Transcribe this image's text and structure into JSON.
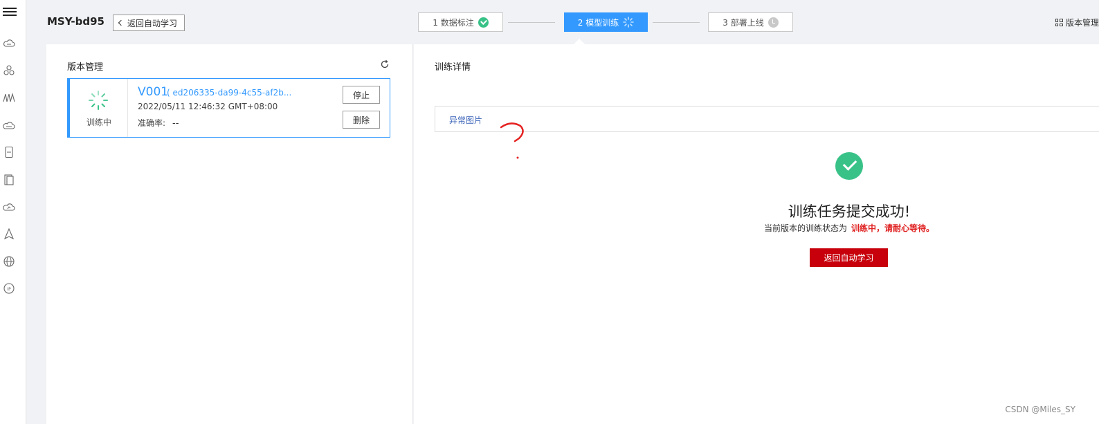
{
  "header": {
    "project_title": "MSY-bd95",
    "back_label": "返回自动学习",
    "version_manage_label": "版本管理"
  },
  "steps": [
    {
      "label": "1 数据标注",
      "status": "done"
    },
    {
      "label": "2 模型训练",
      "status": "active"
    },
    {
      "label": "3 部署上线",
      "status": "pending"
    }
  ],
  "left": {
    "title": "版本管理",
    "version": {
      "status_label": "训练中",
      "name": "V001",
      "id": "( ed206335-da99-4c55-af2b...",
      "time": "2022/05/11 12:46:32 GMT+08:00",
      "accuracy_label": "准确率:",
      "accuracy_value": "--",
      "stop_label": "停止",
      "delete_label": "删除"
    }
  },
  "right": {
    "title": "训练详情",
    "tab_label": "异常图片",
    "success_title": "训练任务提交成功!",
    "success_prefix": "当前版本的训练状态为",
    "success_highlight": "训练中，请耐心等待。",
    "return_label": "返回自动学习"
  },
  "watermark": "CSDN @Miles_SY",
  "colors": {
    "primary": "#3399ff",
    "success": "#39c288",
    "danger_button": "#c7000b",
    "highlight_text": "#e02020"
  }
}
